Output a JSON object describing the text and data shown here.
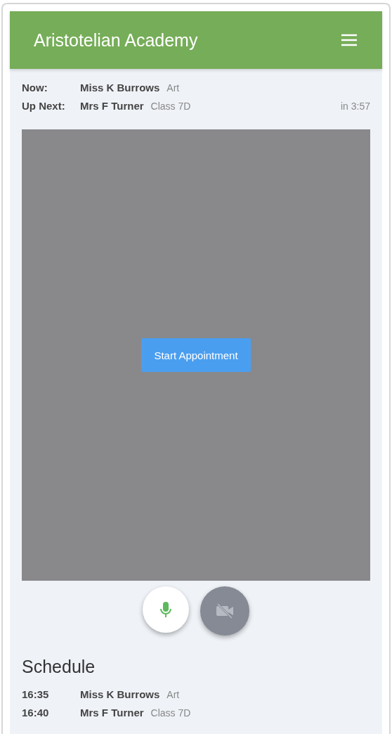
{
  "header": {
    "title": "Aristotelian Academy"
  },
  "status": [
    {
      "label": "Now:",
      "name": "Miss K Burrows",
      "detail": "Art"
    },
    {
      "label": "Up Next:",
      "name": "Mrs F Turner",
      "detail": "Class 7D",
      "countdown": "in 3:57"
    }
  ],
  "video": {
    "button": "Start Appointment"
  },
  "controls": [
    {
      "kind": "microphone",
      "on": true
    },
    {
      "kind": "camera",
      "on": false
    }
  ],
  "schedule": {
    "title": "Schedule",
    "rows": [
      {
        "time": "16:35",
        "name": "Miss K Burrows",
        "detail": "Art"
      },
      {
        "time": "16:40",
        "name": "Mrs F Turner",
        "detail": "Class 7D"
      }
    ]
  }
}
